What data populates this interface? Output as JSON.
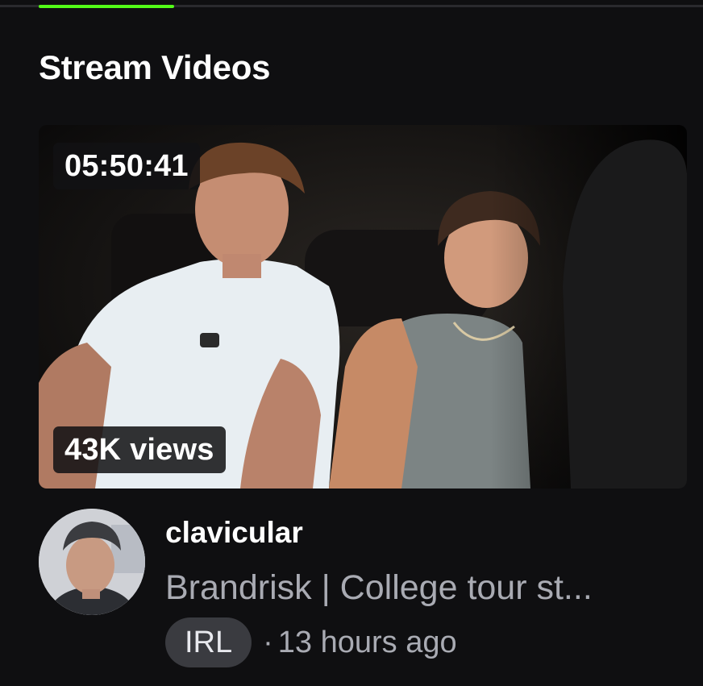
{
  "section": {
    "title": "Stream Videos"
  },
  "video": {
    "duration": "05:50:41",
    "views": "43K views",
    "channel": "clavicular",
    "title": "Brandrisk | College tour st...",
    "category": "IRL",
    "separator": "·",
    "time_ago": "13 hours ago"
  },
  "colors": {
    "background": "#0f0f11",
    "accent": "#53fc18",
    "muted_text": "#a9abb3",
    "chip_bg": "#3a3b40"
  }
}
